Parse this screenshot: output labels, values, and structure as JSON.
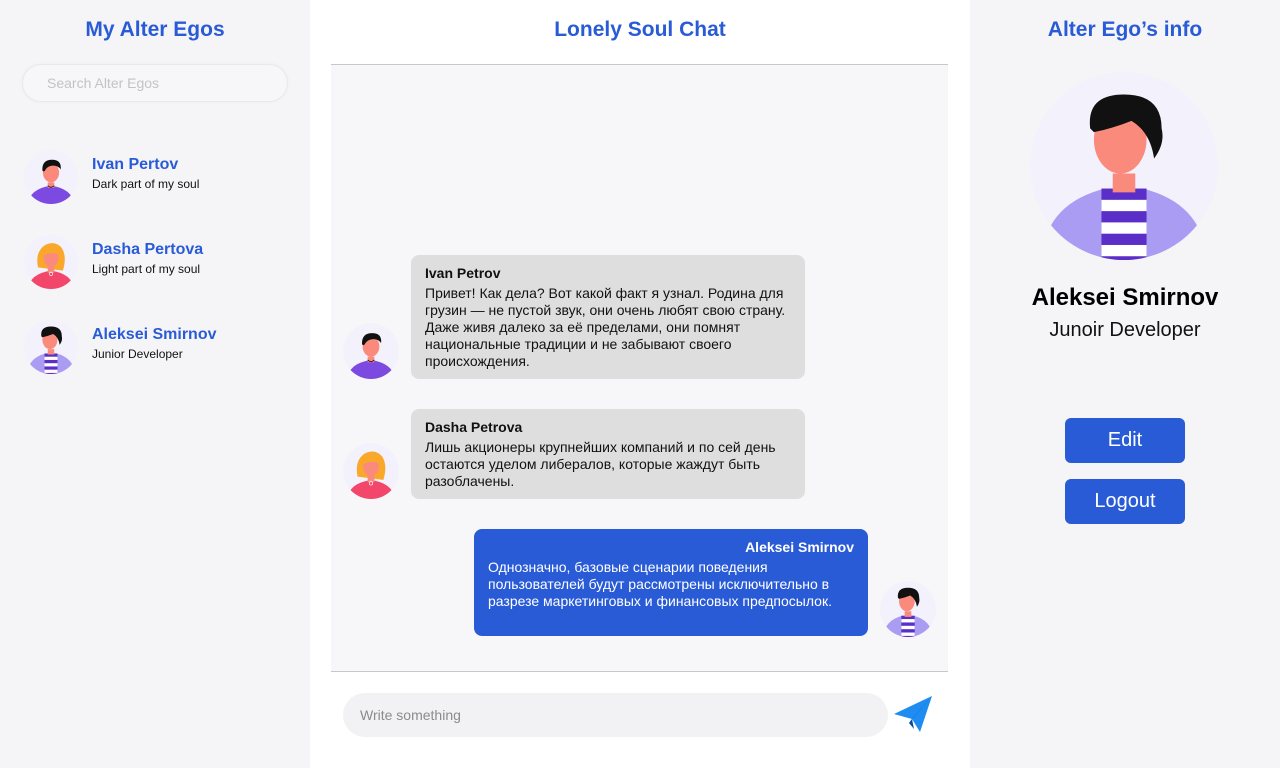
{
  "left_panel": {
    "title": "My Alter Egos",
    "search_placeholder": "Search Alter Egos",
    "egos": [
      {
        "name": "Ivan Pertov",
        "subtitle": "Dark part of my soul",
        "avatar": "man-dark-hair-purple-shirt"
      },
      {
        "name": "Dasha Pertova",
        "subtitle": "Light part of my soul",
        "avatar": "woman-blonde-pink-shirt"
      },
      {
        "name": "Aleksei Smirnov",
        "subtitle": "Junior Developer",
        "avatar": "man-striped-shirt"
      }
    ]
  },
  "chat": {
    "title": "Lonely Soul Chat",
    "messages": [
      {
        "author": "Ivan Petrov",
        "text": "Привет! Как дела? Вот какой факт я узнал. Родина для грузин — не пустой звук, они очень любят свою страну. Даже живя далеко за её пределами, они помнят национальные традиции и не забывают своего происхождения.",
        "direction": "incoming",
        "avatar": "man-dark-hair-purple-shirt"
      },
      {
        "author": "Dasha Petrova",
        "text": "Лишь акционеры крупнейших компаний и по сей день остаются уделом либералов, которые жаждут быть разоблачены.",
        "direction": "incoming",
        "avatar": "woman-blonde-pink-shirt"
      },
      {
        "author": "Aleksei Smirnov",
        "text": "Однозначно, базовые сценарии поведения пользователей будут рассмотрены исключительно в разрезе маркетинговых и финансовых предпосылок.",
        "direction": "outgoing",
        "avatar": "man-striped-shirt"
      }
    ],
    "compose_placeholder": "Write something",
    "send_icon": "paper-plane-icon"
  },
  "right_panel": {
    "title": "Alter Ego’s info",
    "name": "Aleksei Smirnov",
    "role": "Junoir Developer",
    "edit_label": "Edit",
    "logout_label": "Logout",
    "avatar": "man-striped-shirt"
  },
  "colors": {
    "accent": "#2a5bd7",
    "side_bg": "#f5f5f7",
    "chat_bg": "#f7f7f9",
    "incoming_bubble": "#dedede",
    "outgoing_bubble": "#2a5bd7",
    "avatar_bg": "#f3f1fb"
  }
}
